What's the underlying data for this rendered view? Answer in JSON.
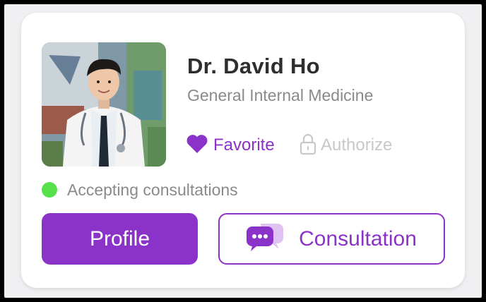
{
  "doctor": {
    "name": "Dr. David Ho",
    "specialty": "General Internal Medicine"
  },
  "actions": {
    "favorite_label": "Favorite",
    "authorize_label": "Authorize"
  },
  "status": {
    "label": "Accepting consultations",
    "color": "#56e04a"
  },
  "buttons": {
    "profile_label": "Profile",
    "consultation_label": "Consultation"
  },
  "colors": {
    "accent": "#8b32c8",
    "muted_text": "#8a8a8a",
    "disabled_text": "#c8c8c8"
  },
  "icons": {
    "favorite": "heart-icon",
    "authorize": "lock-icon",
    "consultation": "chat-bubbles-icon",
    "status": "online-dot"
  }
}
